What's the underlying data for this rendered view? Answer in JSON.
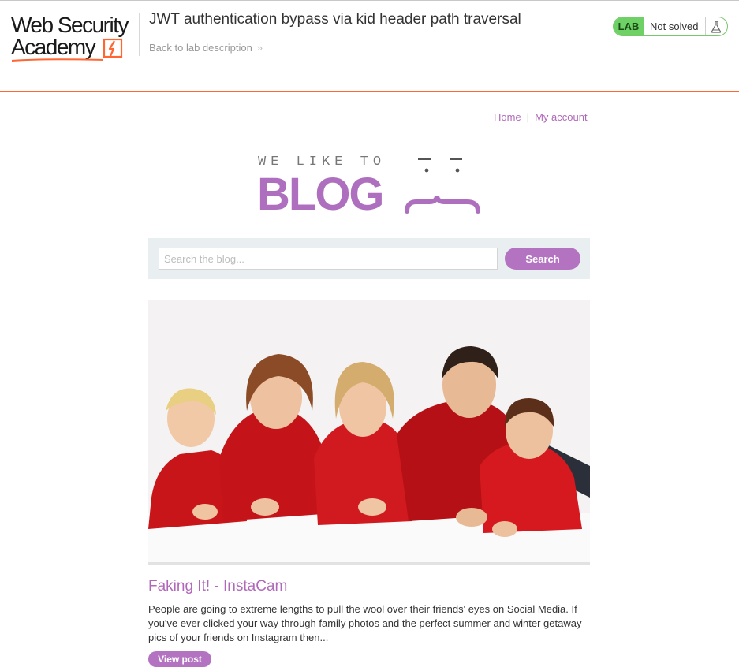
{
  "academy": {
    "logo_line1": "Web Security",
    "logo_line2": "Academy",
    "lab_title": "JWT authentication bypass via kid header path traversal",
    "back_link": "Back to lab description",
    "status_tag": "LAB",
    "status_text": "Not solved",
    "accent_color": "#ff6633"
  },
  "nav": {
    "home": "Home",
    "separator": "|",
    "account": "My account"
  },
  "blog_logo": {
    "tagline": "WE LIKE TO",
    "wordmark": "BLOG",
    "color": "#ae6fbf"
  },
  "search": {
    "placeholder": "Search the blog...",
    "value": "",
    "button_label": "Search"
  },
  "post": {
    "image_icon": "family-photo",
    "title": "Faking It! - InstaCam",
    "excerpt": "People are going to extreme lengths to pull the wool over their friends' eyes on Social Media. If you've ever clicked your way through family photos and the perfect summer and winter getaway pics of your friends on Instagram then...",
    "view_label": "View post"
  },
  "colors": {
    "link_purple": "#b069ba",
    "button_purple": "#b373c1",
    "lab_green": "#6dd165"
  }
}
